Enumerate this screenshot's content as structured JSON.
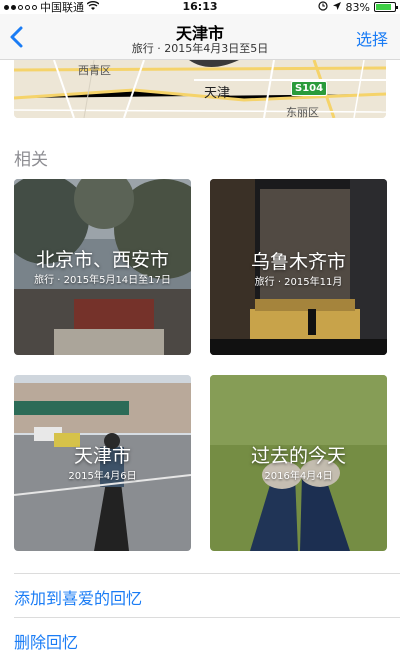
{
  "status_bar": {
    "carrier": "中国联通",
    "time": "16:13",
    "battery": "83%",
    "battery_level": 0.83
  },
  "nav": {
    "title": "天津市",
    "subtitle": "旅行 · 2015年4月3日至5日",
    "select_label": "选择"
  },
  "map": {
    "labels": {
      "district_west": "西青区",
      "city": "天津",
      "highway": "S104",
      "district_east": "东丽区"
    }
  },
  "related": {
    "header": "相关",
    "cards": [
      {
        "title": "北京市、西安市",
        "subtitle": "旅行 · 2015年5月14日至17日"
      },
      {
        "title": "乌鲁木齐市",
        "subtitle": "旅行 · 2015年11月"
      },
      {
        "title": "天津市",
        "subtitle": "2015年4月6日"
      },
      {
        "title": "过去的今天",
        "subtitle": "2016年4月4日"
      }
    ]
  },
  "actions": {
    "add_favorite": "添加到喜爱的回忆",
    "delete_memory": "删除回忆"
  },
  "colors": {
    "accent": "#1a7cf5",
    "header_gray": "#8e8e93"
  }
}
